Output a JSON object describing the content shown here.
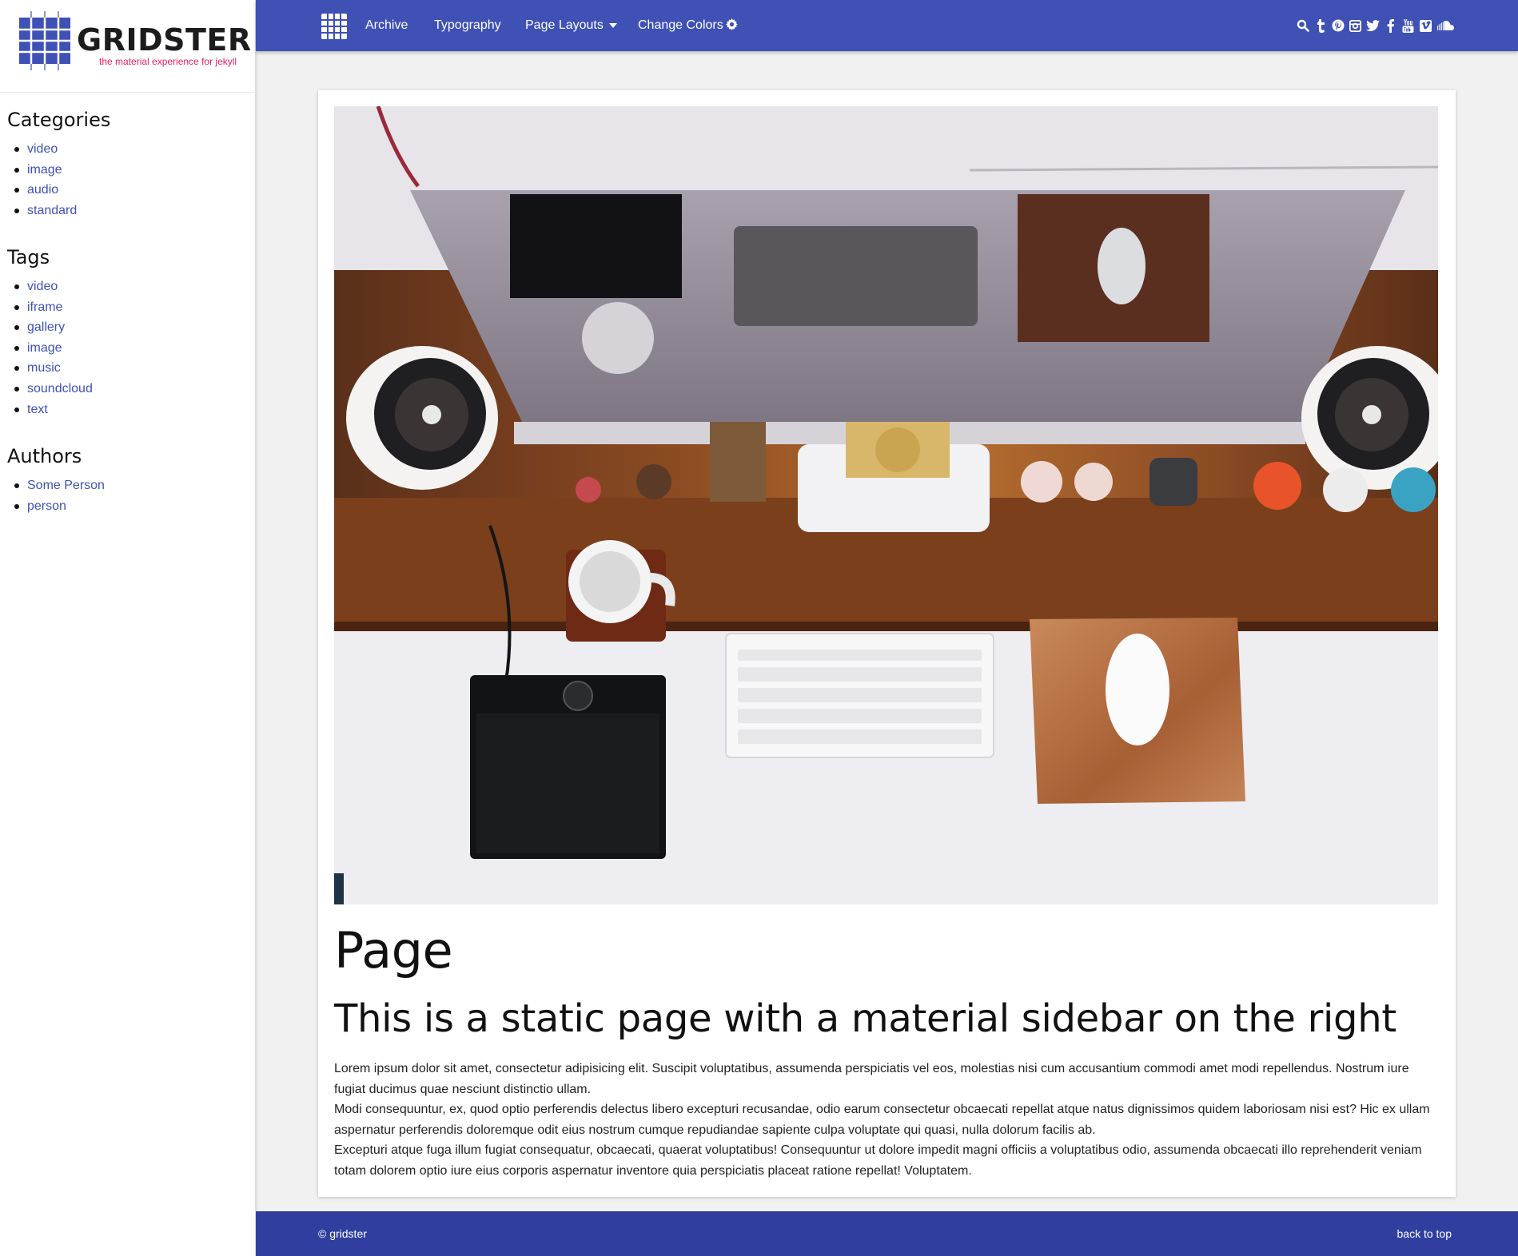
{
  "brand": {
    "name": "GRIDSTER",
    "tagline": "the material experience for jekyll"
  },
  "sidebar": {
    "categories": {
      "title": "Categories",
      "items": [
        "video",
        "image",
        "audio",
        "standard"
      ]
    },
    "tags": {
      "title": "Tags",
      "items": [
        "video",
        "iframe",
        "gallery",
        "image",
        "music",
        "soundcloud",
        "text"
      ]
    },
    "authors": {
      "title": "Authors",
      "items": [
        "Some Person",
        "person"
      ]
    }
  },
  "nav": {
    "links": [
      "Archive",
      "Typography",
      "Page Layouts",
      "Change Colors"
    ],
    "social_icons": [
      "search-icon",
      "tumblr-icon",
      "pinterest-icon",
      "instagram-icon",
      "twitter-icon",
      "facebook-icon",
      "youtube-icon",
      "vimeo-icon",
      "soundcloud-icon"
    ]
  },
  "page": {
    "title": "Page",
    "subtitle": "This is a static page with a material sidebar on the right",
    "paragraphs": [
      "Lorem ipsum dolor sit amet, consectetur adipisicing elit. Suscipit voluptatibus, assumenda perspiciatis vel eos, molestias nisi cum accusantium commodi amet modi repellendus. Nostrum iure fugiat ducimus quae nesciunt distinctio ullam.",
      "Modi consequuntur, ex, quod optio perferendis delectus libero excepturi recusandae, odio earum consectetur obcaecati repellat atque natus dignissimos quidem laboriosam nisi est? Hic ex ullam aspernatur perferendis doloremque odit eius nostrum cumque repudiandae sapiente culpa voluptate qui quasi, nulla dolorum facilis ab.",
      "Excepturi atque fuga illum fugiat consequatur, obcaecati, quaerat voluptatibus! Consequuntur ut dolore impedit magni officiis a voluptatibus odio, assumenda obcaecati illo reprehenderit veniam totam dolorem optio iure eius corporis aspernatur inventore quia perspiciatis placeat ratione repellat! Voluptatem."
    ]
  },
  "footer": {
    "copyright": "© gridster",
    "back_to_top": "back to top"
  },
  "colors": {
    "primary": "#3f51b5",
    "primary_dark": "#303f9f",
    "accent": "#e91e63",
    "background": "#f1f1f1"
  }
}
